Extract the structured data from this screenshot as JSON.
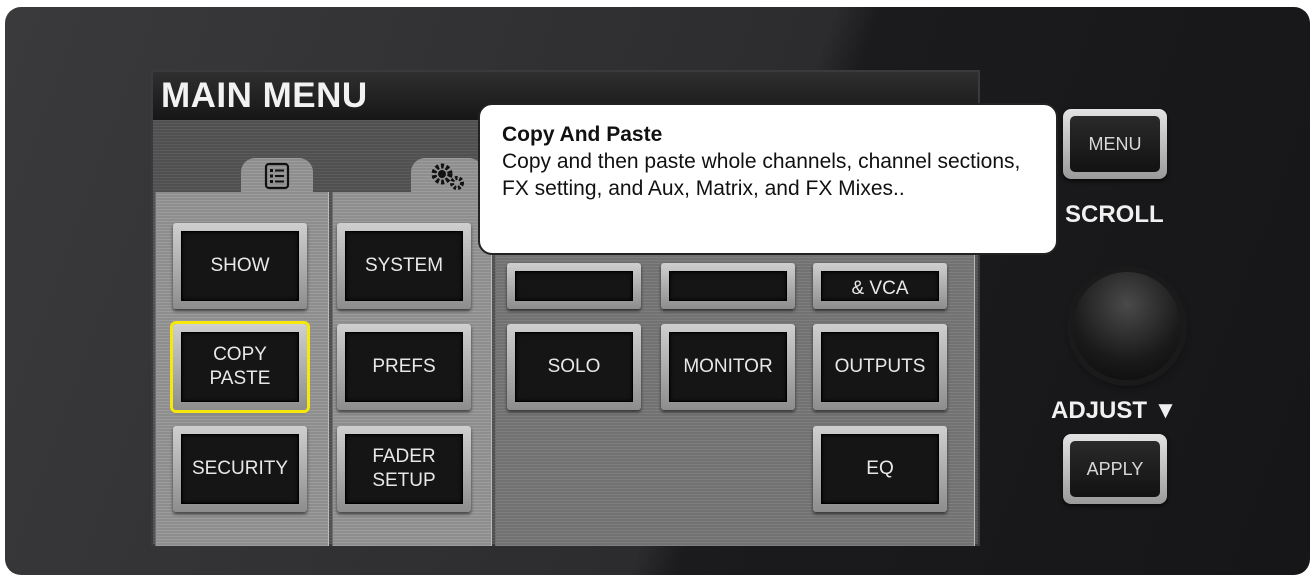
{
  "screen": {
    "title": "MAIN MENU",
    "columns": [
      {
        "icon": "list-icon"
      },
      {
        "icon": "gears-icon"
      }
    ],
    "buttons": {
      "show": "SHOW",
      "system": "SYSTEM",
      "vca_partial": "& VCA",
      "copy_paste": "COPY\nPASTE",
      "prefs": "PREFS",
      "solo": "SOLO",
      "monitor": "MONITOR",
      "outputs": "OUTPUTS",
      "security": "SECURITY",
      "fader_setup": "FADER\nSETUP",
      "eq": "EQ"
    },
    "selected": "copy_paste",
    "selected_color": "#f6e70c"
  },
  "tooltip": {
    "title": "Copy And Paste",
    "body": "Copy and then paste whole channels, channel sections, FX setting, and Aux, Matrix, and FX Mixes.."
  },
  "hardware": {
    "menu_button": "MENU",
    "scroll_label": "SCROLL",
    "adjust_label": "ADJUST ▼",
    "apply_button": "APPLY"
  }
}
